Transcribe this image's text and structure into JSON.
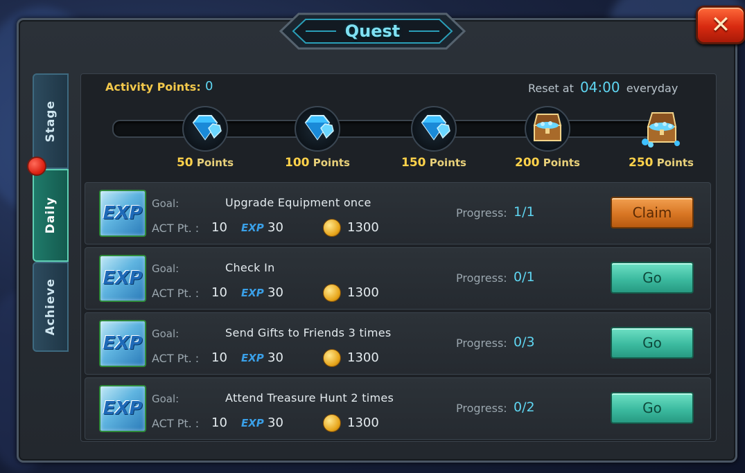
{
  "window": {
    "title": "Quest",
    "close_label": "✕"
  },
  "tabs": [
    {
      "label": "Stage",
      "active": false
    },
    {
      "label": "Daily",
      "active": true,
      "badge": true
    },
    {
      "label": "Achieve",
      "active": false
    }
  ],
  "activity": {
    "label": "Activity Points:",
    "value": "0",
    "reset_prefix": "Reset at",
    "reset_time": "04:00",
    "reset_suffix": "everyday",
    "milestones": [
      {
        "points": "50",
        "unit": "Points",
        "icon": "diamond-icon"
      },
      {
        "points": "100",
        "unit": "Points",
        "icon": "diamond-icon"
      },
      {
        "points": "150",
        "unit": "Points",
        "icon": "diamond-icon"
      },
      {
        "points": "200",
        "unit": "Points",
        "icon": "treasure-chest-icon"
      },
      {
        "points": "250",
        "unit": "Points",
        "icon": "treasure-chest-icon"
      }
    ]
  },
  "quests": [
    {
      "goal_label": "Goal:",
      "goal": "Upgrade Equipment once",
      "act_label": "ACT Pt. :",
      "act": "10",
      "exp_label": "EXP",
      "exp": "30",
      "gold": "1300",
      "progress_label": "Progress:",
      "progress": "1/1",
      "action": "Claim",
      "action_type": "claim"
    },
    {
      "goal_label": "Goal:",
      "goal": "Check In",
      "act_label": "ACT Pt. :",
      "act": "10",
      "exp_label": "EXP",
      "exp": "30",
      "gold": "1300",
      "progress_label": "Progress:",
      "progress": "0/1",
      "action": "Go",
      "action_type": "go"
    },
    {
      "goal_label": "Goal:",
      "goal": "Send Gifts to Friends 3 times",
      "act_label": "ACT Pt. :",
      "act": "10",
      "exp_label": "EXP",
      "exp": "30",
      "gold": "1300",
      "progress_label": "Progress:",
      "progress": "0/3",
      "action": "Go",
      "action_type": "go"
    },
    {
      "goal_label": "Goal:",
      "goal": "Attend Treasure Hunt 2 times",
      "act_label": "ACT Pt. :",
      "act": "10",
      "exp_label": "EXP",
      "exp": "30",
      "gold": "1300",
      "progress_label": "Progress:",
      "progress": "0/2",
      "action": "Go",
      "action_type": "go"
    }
  ],
  "reward_icon": {
    "label": "EXP"
  },
  "colors": {
    "accent": "#5fd6f2",
    "gold_text": "#f2c84b",
    "claim": "#d87624",
    "go": "#3cbba0"
  }
}
